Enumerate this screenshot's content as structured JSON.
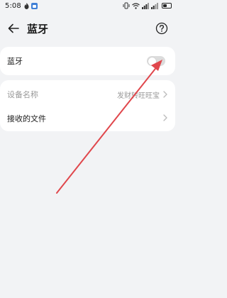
{
  "status_bar": {
    "time": "5:08",
    "icons": [
      "flame-icon",
      "app-icon",
      "vibrate-icon",
      "wifi-icon",
      "signal-icon",
      "signal-icon",
      "battery-icon"
    ],
    "battery_level": 0.45
  },
  "header": {
    "title": "蓝牙",
    "back_icon": "arrow-left-icon",
    "help_icon": "question-circle-icon"
  },
  "settings": {
    "bluetooth": {
      "label": "蓝牙",
      "toggle_on": false
    },
    "device_name": {
      "label": "设备名称",
      "value": "发财转旺旺宝"
    },
    "received_files": {
      "label": "接收的文件"
    }
  },
  "colors": {
    "background": "#f2f3f5",
    "card": "#ffffff",
    "annotation_arrow": "#e0474c",
    "toggle_off": "#dcdcdc"
  }
}
